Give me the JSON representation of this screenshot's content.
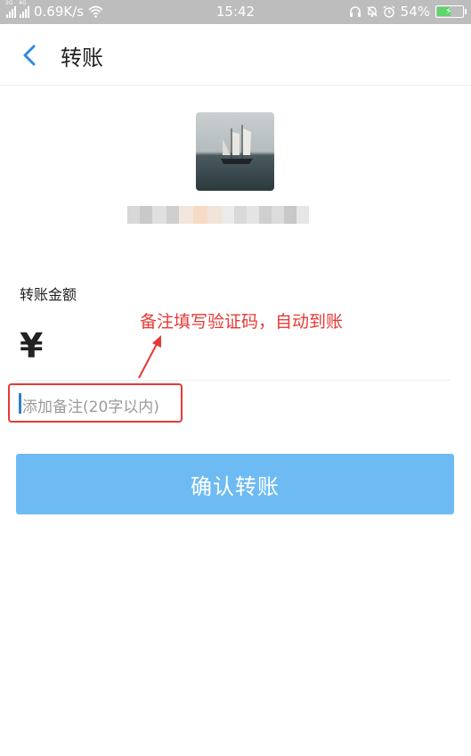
{
  "status_bar": {
    "net_2g": "2G",
    "net_4g": "4G",
    "speed": "0.69K/s",
    "time": "15:42",
    "battery": "54%",
    "battery_level": 0.54
  },
  "header": {
    "back_icon": "chevron-left-icon",
    "title": "转账"
  },
  "payee": {
    "avatar": "sailing-ship-photo",
    "name": ""
  },
  "form": {
    "amount_label": "转账金额",
    "currency_symbol": "¥",
    "amount_value": "",
    "remark_placeholder": "添加备注(20字以内)"
  },
  "annotation": {
    "text": "备注填写验证码，自动到账"
  },
  "confirm_button": {
    "label": "确认转账"
  },
  "colors": {
    "accent": "#2d7fcf",
    "button": "#6dbbf2",
    "annotation": "#e53935",
    "status_bar": "#bdbdbd"
  }
}
